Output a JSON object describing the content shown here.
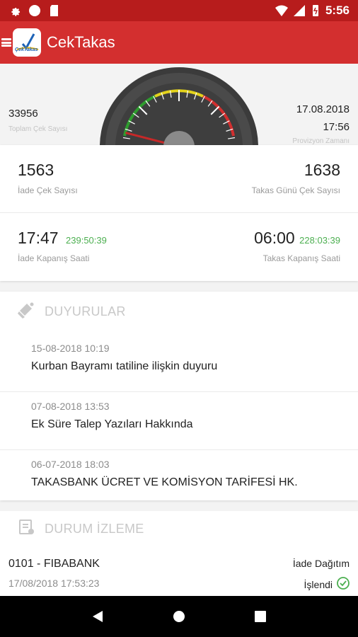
{
  "status_bar": {
    "time": "5:56"
  },
  "app_bar": {
    "title": "CekTakas",
    "logo_text": "ÇekTakas"
  },
  "gauge": {
    "left_value": "33956",
    "left_label": "Toplam Çek Sayısı",
    "right_date": "17.08.2018",
    "right_time": "17:56",
    "right_label": "Provizyon Zamanı",
    "needle_level": 0.08
  },
  "stats": {
    "return_count": "1563",
    "return_count_label": "İade Çek Sayısı",
    "clearing_count": "1638",
    "clearing_count_label": "Takas Günü Çek Sayısı",
    "return_close_time": "17:47",
    "return_close_remaining": "239:50:39",
    "return_close_label": "İade Kapanış Saati",
    "clearing_close_time": "06:00",
    "clearing_close_remaining": "228:03:39",
    "clearing_close_label": "Takas Kapanış Saati"
  },
  "announcements": {
    "title": "DUYURULAR",
    "items": [
      {
        "date": "15-08-2018 10:19",
        "text": "Kurban Bayramı tatiline ilişkin duyuru"
      },
      {
        "date": "07-08-2018 13:53",
        "text": "Ek Süre Talep Yazıları Hakkında"
      },
      {
        "date": "06-07-2018 18:03",
        "text": "TAKASBANK ÜCRET VE KOMİSYON TARİFESİ HK."
      }
    ]
  },
  "status_monitor": {
    "title": "DURUM İZLEME",
    "bank": "0101 - FIBABANK",
    "timestamp": "17/08/2018 17:53:23",
    "type": "İade Dağıtım",
    "status": "İşlendi"
  },
  "colors": {
    "status_bar": "#b71c1c",
    "app_bar": "#d32f2f",
    "accent_green": "#4caf50",
    "needle": "#c62828"
  }
}
